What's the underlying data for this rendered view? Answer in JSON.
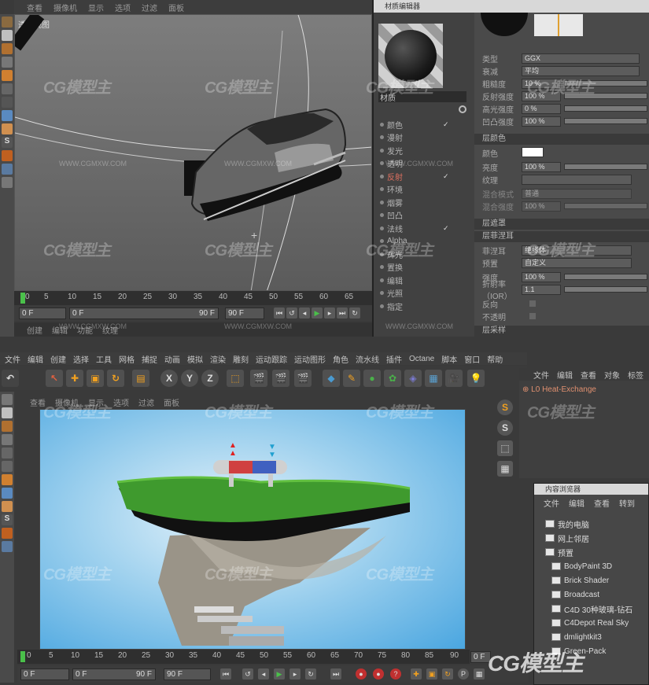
{
  "top": {
    "viewport_menu": [
      "查看",
      "摄像机",
      "显示",
      "选项",
      "过滤",
      "面板"
    ],
    "viewport_label": "透视视图",
    "timeline_ticks": [
      "0",
      "5",
      "10",
      "15",
      "20",
      "25",
      "30",
      "35",
      "40",
      "45",
      "50",
      "55",
      "60",
      "65"
    ],
    "playbar": {
      "start": "0 F",
      "cur": "0 F",
      "range_end": "90 F",
      "end": "90 F"
    },
    "bottom_tabs": [
      "创建",
      "编辑",
      "功能",
      "纹理"
    ],
    "material_editor": {
      "title": "材质编辑器",
      "name": "材质",
      "channels": [
        {
          "label": "颜色",
          "checked": true
        },
        {
          "label": "漫射",
          "checked": false
        },
        {
          "label": "发光",
          "checked": false
        },
        {
          "label": "透明",
          "checked": false
        },
        {
          "label": "反射",
          "checked": true,
          "active": true
        },
        {
          "label": "环境",
          "checked": false
        },
        {
          "label": "烟雾",
          "checked": false
        },
        {
          "label": "凹凸",
          "checked": false
        },
        {
          "label": "法线",
          "checked": true
        },
        {
          "label": "Alpha",
          "checked": false
        },
        {
          "label": "辉光",
          "checked": false
        },
        {
          "label": "置换",
          "checked": false
        },
        {
          "label": "编辑",
          "checked": false
        },
        {
          "label": "光照",
          "checked": false
        },
        {
          "label": "指定",
          "checked": false
        }
      ],
      "props": {
        "type_label": "类型",
        "type_value": "GGX",
        "falloff_label": "衰减",
        "falloff_value": "平均",
        "roughness_label": "粗糙度",
        "roughness_value": "10 %",
        "refl_label": "反射强度",
        "refl_value": "100 %",
        "spec_label": "高光强度",
        "spec_value": "0 %",
        "bump_label": "凹凸强度",
        "bump_value": "100 %",
        "section_layer_color": "层颜色",
        "color_label": "颜色",
        "brightness_label": "亮度",
        "brightness_value": "100 %",
        "texture_label": "纹理",
        "mix_mode_label": "混合模式",
        "mix_mode_value": "普通",
        "mix_strength_label": "混合强度",
        "mix_strength_value": "100 %",
        "section_layer_mask": "层遮罩",
        "section_layer_fresnel": "层菲涅耳",
        "fresnel_label": "菲涅耳",
        "fresnel_value": "绝缘体",
        "preset_label": "预置",
        "preset_value": "自定义",
        "strength_label": "强度",
        "strength_value": "100 %",
        "ior_label": "折射率（IOR）",
        "ior_value": "1.1",
        "invert_label": "反向",
        "opaque_label": "不透明",
        "section_layer_sampling": "层采样"
      }
    }
  },
  "bottom": {
    "main_menu": [
      "文件",
      "编辑",
      "创建",
      "选择",
      "工具",
      "网格",
      "捕捉",
      "动画",
      "模拟",
      "渲染",
      "雕刻",
      "运动跟踪",
      "运动图形",
      "角色",
      "流水线",
      "插件",
      "Octane",
      "脚本",
      "窗口",
      "帮助"
    ],
    "axis_buttons": [
      "X",
      "Y",
      "Z"
    ],
    "viewport_menu": [
      "查看",
      "摄像机",
      "显示",
      "选项",
      "过滤",
      "面板"
    ],
    "timeline_ticks": [
      "0",
      "5",
      "10",
      "15",
      "20",
      "25",
      "30",
      "35",
      "40",
      "45",
      "50",
      "55",
      "60",
      "65",
      "70",
      "75",
      "80",
      "85",
      "90"
    ],
    "playbar": {
      "start": "0 F",
      "cur": "0 F",
      "range_end": "90 F",
      "end": "90 F",
      "frame_end": "0 F"
    },
    "object_manager": {
      "menu": [
        "文件",
        "编辑",
        "查看",
        "对象",
        "标签"
      ],
      "item": "Heat-Exchange"
    },
    "content_browser": {
      "title": "内容浏览器",
      "menu": [
        "文件",
        "编辑",
        "查看",
        "转到"
      ],
      "items": [
        "我的电脑",
        "网上邻居",
        "预置",
        "BodyPaint 3D",
        "Brick Shader",
        "Broadcast",
        "C4D 30种玻璃-钻石",
        "C4Depot Real Sky",
        "dmlightkit3",
        "Green-Pack"
      ]
    }
  },
  "watermark": {
    "brand": "CG模型主",
    "url": "WWW.CGMXW.COM"
  },
  "colors": {
    "accent_orange": "#f0a020",
    "active_red": "#e07060",
    "sky_blue": "#4aa6e0"
  }
}
